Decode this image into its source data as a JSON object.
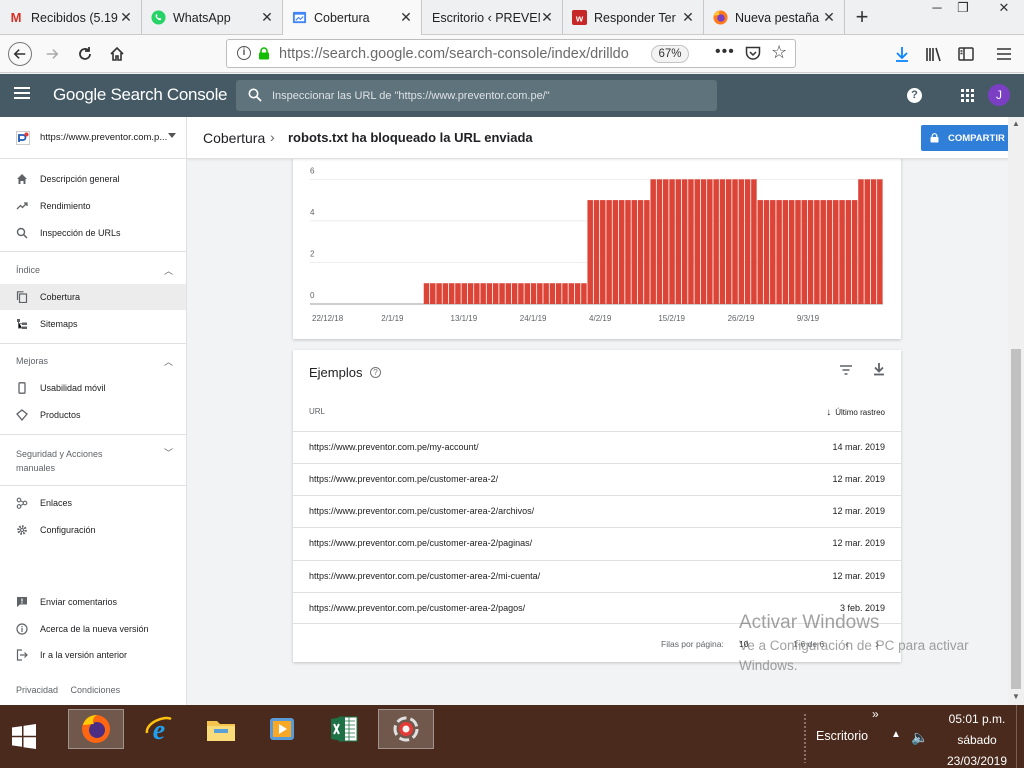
{
  "browser": {
    "tabs": [
      {
        "title": "Recibidos (5.19",
        "icon": "gmail-icon",
        "active": false
      },
      {
        "title": "WhatsApp",
        "icon": "whatsapp-icon",
        "active": false
      },
      {
        "title": "Cobertura",
        "icon": "search-console-icon",
        "active": true
      },
      {
        "title": "Escritorio ‹ PREVEN",
        "icon": "none",
        "active": false
      },
      {
        "title": "Responder Ter",
        "icon": "responder-icon",
        "active": false
      },
      {
        "title": "Nueva pestaña",
        "icon": "firefox-icon",
        "active": false
      }
    ],
    "url": "https://search.google.com/search-console/index/drilldo",
    "zoom": "67%"
  },
  "gsc": {
    "logo": "Google Search Console",
    "search_placeholder": "Inspeccionar las URL de \"https://www.preventor.com.pe/\"",
    "avatar_letter": "J",
    "property": "https://www.preventor.com.p..."
  },
  "sidebar": {
    "items_top": [
      {
        "label": "Descripción general",
        "icon": "home-icon"
      },
      {
        "label": "Rendimiento",
        "icon": "trending-up-icon"
      },
      {
        "label": "Inspección de URLs",
        "icon": "search-icon"
      }
    ],
    "section_index": "Índice",
    "items_index": [
      {
        "label": "Cobertura",
        "icon": "copy-icon",
        "selected": true
      },
      {
        "label": "Sitemaps",
        "icon": "sitemap-icon"
      }
    ],
    "section_improvements": "Mejoras",
    "items_improvements": [
      {
        "label": "Usabilidad móvil",
        "icon": "phone-icon"
      },
      {
        "label": "Productos",
        "icon": "diamond-icon"
      }
    ],
    "section_security": "Seguridad y Acciones manuales",
    "items_links": [
      {
        "label": "Enlaces",
        "icon": "links-icon"
      },
      {
        "label": "Configuración",
        "icon": "gear-icon"
      }
    ],
    "items_bottom": [
      {
        "label": "Enviar comentarios",
        "icon": "feedback-icon"
      },
      {
        "label": "Acerca de la nueva versión",
        "icon": "info-icon"
      },
      {
        "label": "Ir a la versión anterior",
        "icon": "exit-icon"
      }
    ],
    "footer": {
      "privacy": "Privacidad",
      "terms": "Condiciones"
    }
  },
  "breadcrumb": {
    "parent": "Cobertura",
    "current": "robots.txt ha bloqueado la URL enviada",
    "share_label": "COMPARTIR"
  },
  "chart_data": {
    "type": "bar",
    "color": "#db4437",
    "yticks": [
      0,
      2,
      4,
      6
    ],
    "ylim": [
      0,
      6.4
    ],
    "xtick_labels": [
      "22/12/18",
      "2/1/19",
      "13/1/19",
      "24/1/19",
      "4/2/19",
      "15/2/19",
      "26/2/19",
      "9/3/19"
    ],
    "categories_note": "one bar per day from 22/12/18 to 23/3/19",
    "segments": [
      {
        "from": "22/12/18",
        "to": "8/1/19",
        "value": 0
      },
      {
        "from": "9/1/19",
        "to": "3/2/19",
        "value": 1
      },
      {
        "from": "4/2/19",
        "to": "13/2/19",
        "value": 5
      },
      {
        "from": "14/2/19",
        "to": "2/3/19",
        "value": 6
      },
      {
        "from": "3/3/19",
        "to": "18/3/19",
        "value": 5
      },
      {
        "from": "19/3/19",
        "to": "22/3/19",
        "value": 6
      }
    ]
  },
  "examples": {
    "title": "Ejemplos",
    "col_url": "URL",
    "col_date": "Último rastreo",
    "rows": [
      {
        "url": "https://www.preventor.com.pe/my-account/",
        "date": "14 mar. 2019"
      },
      {
        "url": "https://www.preventor.com.pe/customer-area-2/",
        "date": "12 mar. 2019"
      },
      {
        "url": "https://www.preventor.com.pe/customer-area-2/archivos/",
        "date": "12 mar. 2019"
      },
      {
        "url": "https://www.preventor.com.pe/customer-area-2/paginas/",
        "date": "12 mar. 2019"
      },
      {
        "url": "https://www.preventor.com.pe/customer-area-2/mi-cuenta/",
        "date": "12 mar. 2019"
      },
      {
        "url": "https://www.preventor.com.pe/customer-area-2/pagos/",
        "date": "3 feb. 2019"
      }
    ],
    "pager_label": "Filas por página:",
    "pager_value": "10",
    "pager_range": "1-6 de 6"
  },
  "watermark": {
    "line1": "Activar Windows",
    "line2": "Ve a Configuración de PC para activar Windows."
  },
  "taskbar": {
    "desktop_label": "Escritorio",
    "time": "05:01 p.m.",
    "day": "sábado",
    "date": "23/03/2019"
  }
}
